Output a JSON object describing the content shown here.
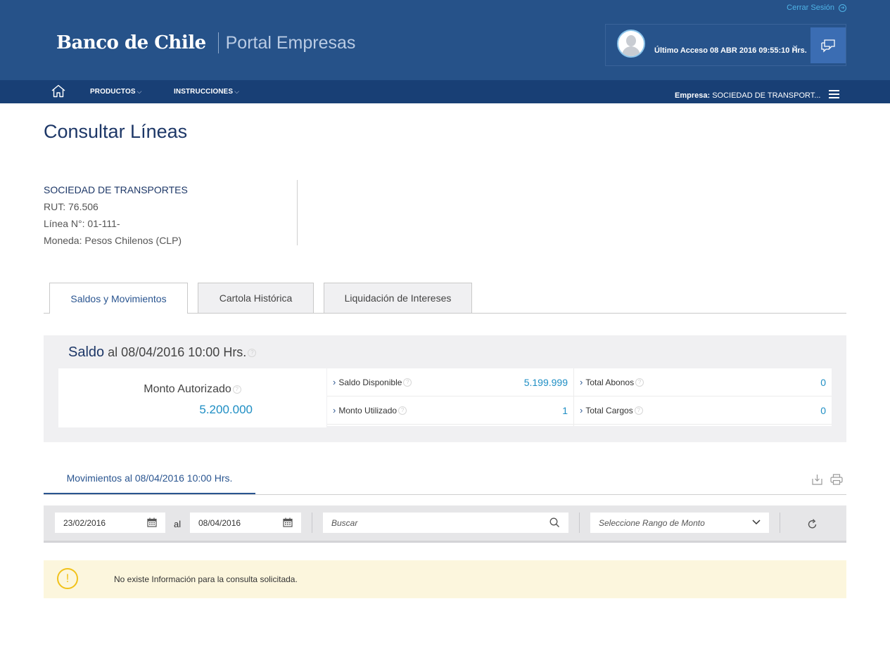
{
  "header": {
    "logout_label": "Cerrar Sesión",
    "logo_text": "Banco de Chile",
    "portal_text": "Portal Empresas",
    "last_access": "Último Acceso 08 ABR 2016 09:55:10 Hrs.",
    "close_glyph": "✕"
  },
  "nav": {
    "home_icon": "home-icon",
    "items": [
      {
        "label": "PRODUCTOS"
      },
      {
        "label": "INSTRUCCIONES"
      }
    ],
    "empresa_label": "Empresa:",
    "empresa_value": "SOCIEDAD DE TRANSPORT..."
  },
  "page": {
    "title": "Consultar Líneas"
  },
  "info": {
    "company": "SOCIEDAD DE TRANSPORTES",
    "rut": "RUT: 76.506",
    "linea": "Línea N°: 01-111-",
    "moneda": "Moneda: Pesos Chilenos (CLP)"
  },
  "tabs": [
    {
      "label": "Saldos y Movimientos",
      "active": true
    },
    {
      "label": "Cartola Histórica",
      "active": false
    },
    {
      "label": "Liquidación de Intereses",
      "active": false
    }
  ],
  "saldo": {
    "title": "Saldo",
    "date": "al 08/04/2016 10:00 Hrs.",
    "monto_autorizado_label": "Monto Autorizado",
    "monto_autorizado_value": "5.200.000",
    "cells": [
      {
        "label": "Saldo Disponible",
        "value": "5.199.999"
      },
      {
        "label": "Total Abonos",
        "value": "0"
      },
      {
        "label": "Monto Utilizado",
        "value": "1"
      },
      {
        "label": "Total Cargos",
        "value": "0"
      }
    ]
  },
  "movimientos": {
    "tab_label": "Movimientos al 08/04/2016 10:00 Hrs.",
    "date_from": "23/02/2016",
    "date_sep": "al",
    "date_to": "08/04/2016",
    "search_placeholder": "Buscar",
    "range_placeholder": "Seleccione Rango de Monto"
  },
  "alert": {
    "icon": "!",
    "message": "No existe Información para la consulta solicitada."
  },
  "colors": {
    "header_bg": "#265289",
    "nav_bg": "#183f75",
    "accent_blue": "#1e8ec4",
    "title_blue": "#1d3767",
    "alert_bg": "#fcf6dd",
    "warn_yellow": "#f1c21b"
  }
}
